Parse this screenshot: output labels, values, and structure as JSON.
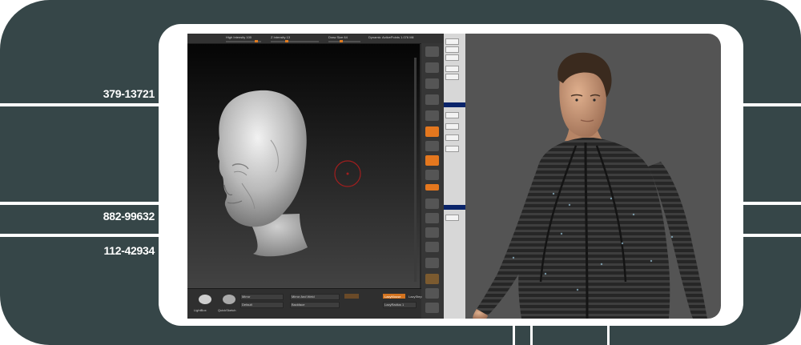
{
  "frame": {
    "side_numbers": [
      "379-13721",
      "882-99632",
      "112-42934"
    ],
    "colors": {
      "frame": "#364648",
      "accent": "#e4771e",
      "viewport": "#1e1e1e",
      "render_bg": "#545454"
    }
  },
  "sculpt_app": {
    "top_bar": {
      "items": [
        "High Intensity 100",
        "Z Intensity 13",
        "Draw Size 64",
        "Dynamic",
        "ActivePoints 1.076 Mil",
        "TotalPoints 1.076 Mil"
      ]
    },
    "bottom_bar": {
      "labels": [
        "LightBox",
        "QuickSketch",
        "Mirror",
        "Mirror And Weld",
        "Default",
        "Backface",
        "LazyMouse",
        "LazyStep",
        "LazyRadius 1"
      ]
    },
    "icons": [
      "head-3d-model",
      "brush-cursor-icon"
    ]
  },
  "render": {
    "subject": "character-render",
    "icons": [
      "character-head",
      "striped-bodysuit"
    ]
  }
}
